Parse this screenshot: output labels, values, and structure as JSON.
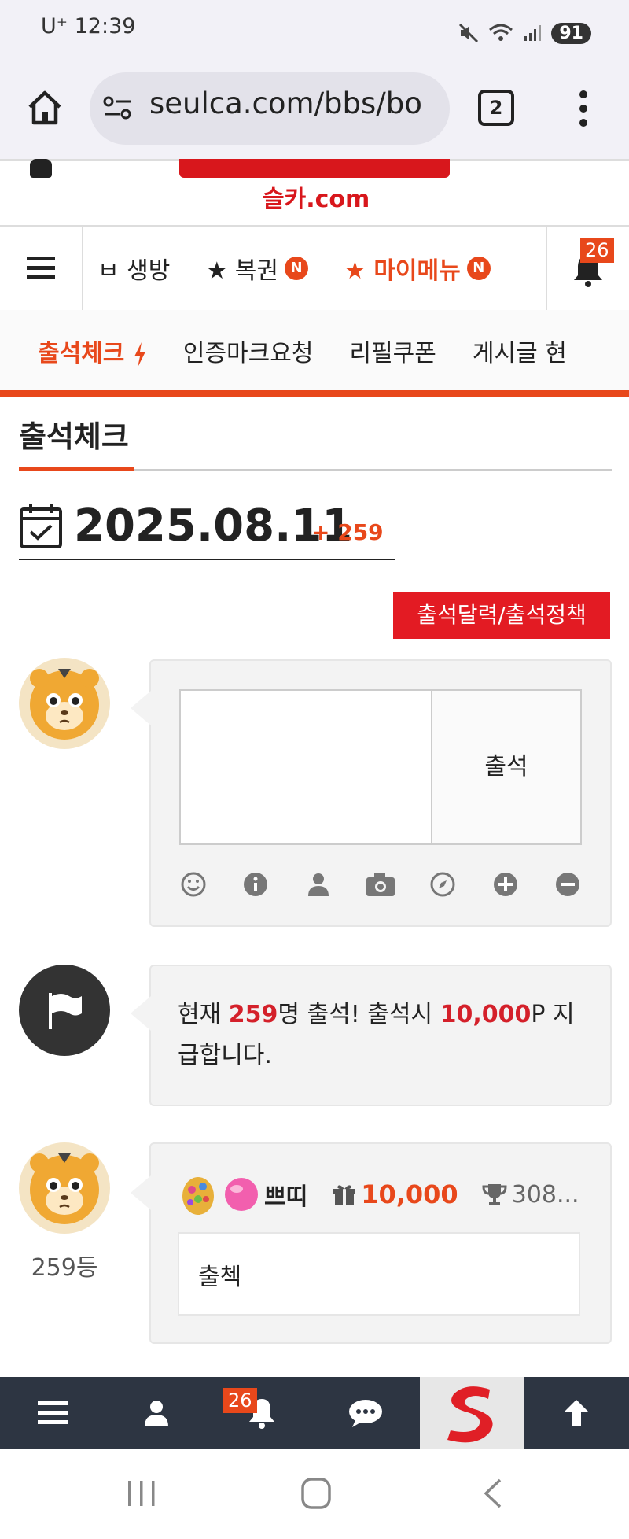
{
  "status": {
    "time": "12:39",
    "carrier": "U⁺",
    "battery": "91"
  },
  "browser": {
    "url": "seulca.com/bbs/bo",
    "tab_count": "2"
  },
  "site": {
    "logo_text": "슬카.com"
  },
  "nav": {
    "items": [
      {
        "label": "ㅂ 생방",
        "new": ""
      },
      {
        "label": "★ 복권",
        "new": "N"
      },
      {
        "label": "★ 마이메뉴",
        "new": "N"
      }
    ],
    "bell_count": "26"
  },
  "subnav": {
    "items": [
      "출석체크",
      "인증마크요청",
      "리필쿠폰",
      "게시글 현"
    ]
  },
  "page": {
    "title": "출석체크",
    "date": "2025.08.11",
    "count": "+ 259",
    "calendar_button": "출석달력/출석정책"
  },
  "input": {
    "submit_label": "출석",
    "textarea_value": ""
  },
  "info": {
    "prefix": "현재 ",
    "count": "259",
    "mid": "명 출석! 출석시 ",
    "points": "10,000",
    "suffix": "P 지급합니다."
  },
  "comment": {
    "rank": "259등",
    "nickname": "쁘띠",
    "points": "10,000",
    "trophy": "308...",
    "text": "출첵"
  },
  "bottom": {
    "bell_count": "26"
  },
  "colors": {
    "accent": "#e8481b",
    "button_red": "#e31b23",
    "bottom_bar": "#2d3542"
  }
}
